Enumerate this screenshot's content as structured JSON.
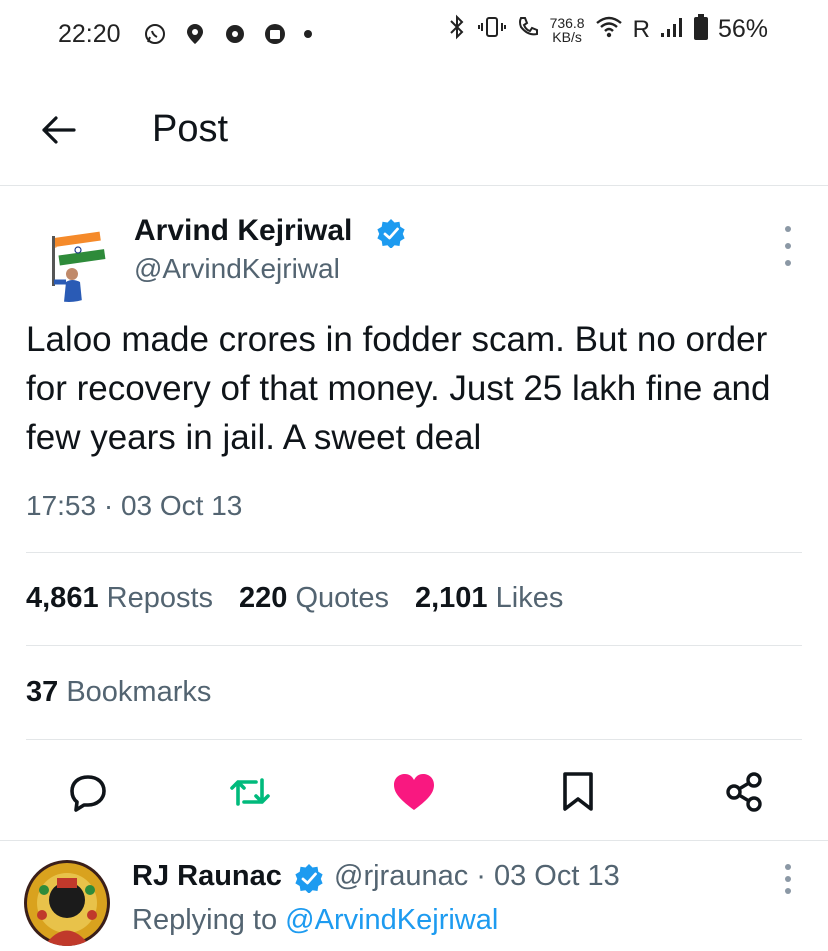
{
  "status_bar": {
    "time": "22:20",
    "left_icons": [
      "whatsapp-icon",
      "notification-icon",
      "app-icon",
      "app-icon-2"
    ],
    "speed_value": "736.8",
    "speed_unit": "KB/s",
    "roaming": "R",
    "battery": "56%"
  },
  "header": {
    "title": "Post"
  },
  "tweet": {
    "author_name": "Arvind Kejriwal",
    "author_handle": "@ArvindKejriwal",
    "text": "Laloo made crores in fodder scam. But no order for recovery of that money. Just 25 lakh fine and few years in jail. A sweet deal",
    "timestamp": "17:53 · 03 Oct 13",
    "reposts_count": "4,861",
    "reposts_label": "Reposts",
    "quotes_count": "220",
    "quotes_label": "Quotes",
    "likes_count": "2,101",
    "likes_label": "Likes",
    "bookmarks_count": "37",
    "bookmarks_label": "Bookmarks"
  },
  "reply": {
    "author_name": "RJ Raunac",
    "meta": "@rjraunac · 03 Oct 13",
    "replying_prefix": "Replying to",
    "replying_handle": "@ArvindKejriwal"
  },
  "colors": {
    "accent": "#1d9bf0",
    "repost_green": "#00ba7c",
    "like_pink": "#f91880",
    "muted": "#536471"
  }
}
